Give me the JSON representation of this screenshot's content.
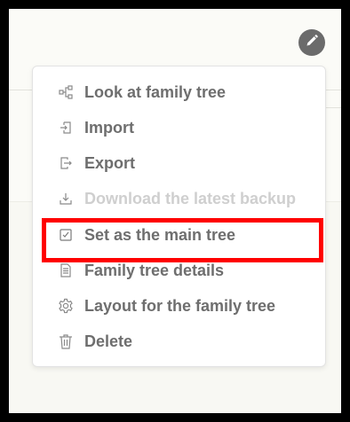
{
  "menu": {
    "items": [
      {
        "label": "Look at family tree",
        "icon": "tree-structure-icon",
        "disabled": false
      },
      {
        "label": "Import",
        "icon": "import-icon",
        "disabled": false
      },
      {
        "label": "Export",
        "icon": "export-icon",
        "disabled": false
      },
      {
        "label": "Download the latest backup",
        "icon": "download-icon",
        "disabled": true
      },
      {
        "label": "Set as the main tree",
        "icon": "checkbox-icon",
        "disabled": false
      },
      {
        "label": "Family tree details",
        "icon": "details-icon",
        "disabled": false
      },
      {
        "label": "Layout for the family tree",
        "icon": "gear-icon",
        "disabled": false
      },
      {
        "label": "Delete",
        "icon": "trash-icon",
        "disabled": false
      }
    ]
  },
  "edit_button": {
    "icon": "pencil-icon"
  },
  "highlight": {
    "target": "Set as the main tree",
    "color": "#ff0000"
  },
  "colors": {
    "text": "#6e6e6e",
    "disabled_text": "#cfcfcf",
    "edit_button": "#6b6b6b",
    "frame": "#000000"
  }
}
